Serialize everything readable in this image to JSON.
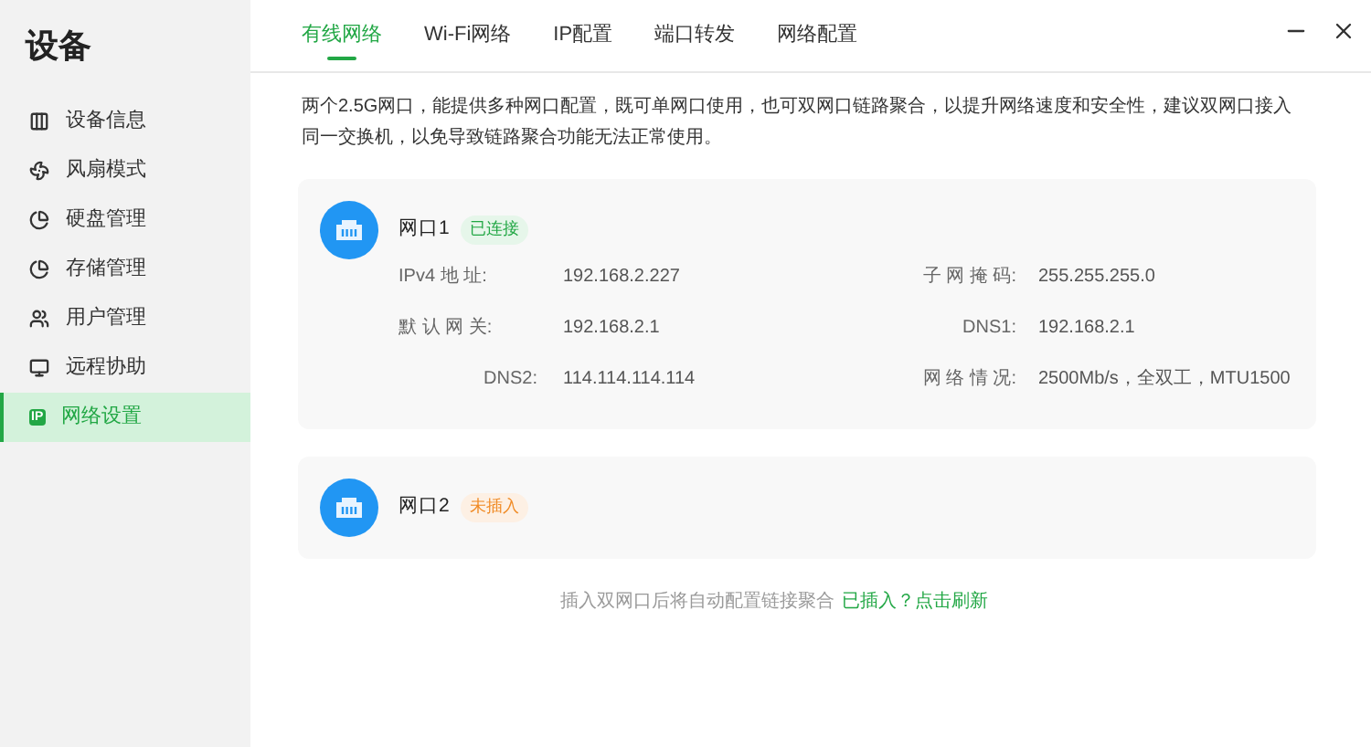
{
  "sidebar": {
    "title": "设备",
    "items": [
      {
        "label": "设备信息",
        "selected": false
      },
      {
        "label": "风扇模式",
        "selected": false
      },
      {
        "label": "硬盘管理",
        "selected": false
      },
      {
        "label": "存储管理",
        "selected": false
      },
      {
        "label": "用户管理",
        "selected": false
      },
      {
        "label": "远程协助",
        "selected": false
      },
      {
        "label": "网络设置",
        "selected": true,
        "icon_text": "IP"
      }
    ]
  },
  "tabs": [
    {
      "label": "有线网络",
      "selected": true
    },
    {
      "label": "Wi-Fi网络",
      "selected": false
    },
    {
      "label": "IP配置",
      "selected": false
    },
    {
      "label": "端口转发",
      "selected": false
    },
    {
      "label": "网络配置",
      "selected": false
    }
  ],
  "description": "两个2.5G网口，能提供多种网口配置，既可单网口使用，也可双网口链路聚合，以提升网络速度和安全性，建议双网口接入同一交换机，以免导致链路聚合功能无法正常使用。",
  "ports": [
    {
      "name": "网口1",
      "status": "已连接",
      "kind": "connected",
      "fields": [
        {
          "label": "IPv4 地 址:",
          "value": "192.168.2.227"
        },
        {
          "label": "子 网 掩 码:",
          "value": "255.255.255.0"
        },
        {
          "label": "默 认 网 关:",
          "value": "192.168.2.1"
        },
        {
          "label": "DNS1:",
          "value": "192.168.2.1"
        },
        {
          "label": "DNS2:",
          "value": "114.114.114.114"
        },
        {
          "label": "网 络 情 况:",
          "value": "2500Mb/s，全双工，MTU1500"
        }
      ]
    },
    {
      "name": "网口2",
      "status": "未插入",
      "kind": "unplugged"
    }
  ],
  "footer": {
    "text": "插入双网口后将自动配置链接聚合",
    "link": "已插入？点击刷新"
  }
}
